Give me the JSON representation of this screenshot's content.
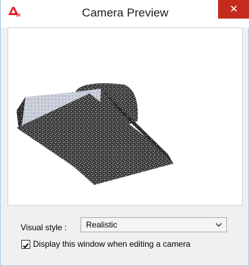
{
  "window": {
    "title": "Camera Preview",
    "app_icon_text": "A18",
    "close_symbol": "✕"
  },
  "preview": {
    "content": "realistic 3D model render",
    "icon": "3d-model-render"
  },
  "visual_style": {
    "label": "Visual style :",
    "value": "Realistic"
  },
  "display_option": {
    "label": "Display this window when editing a camera",
    "checked": true
  },
  "colors": {
    "close_button": "#c42b1c",
    "window_border": "#a9c7e6",
    "dialog_background": "#f0f0f0"
  }
}
